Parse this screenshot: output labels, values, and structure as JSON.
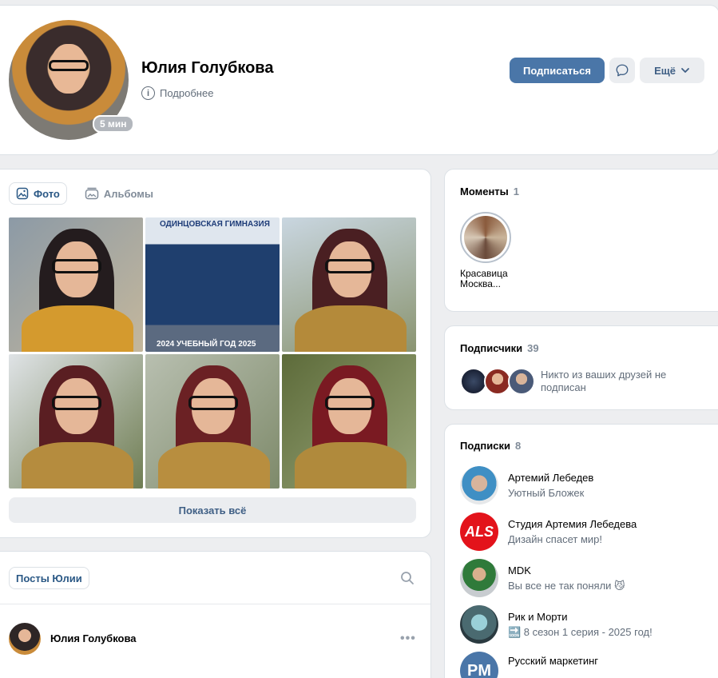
{
  "profile": {
    "name": "Юлия Голубкова",
    "details_link": "Подробнее",
    "online_badge": "5 мин",
    "subscribe_label": "Подписаться",
    "more_label": "Ещё"
  },
  "photos": {
    "tabs": [
      {
        "label": "Фото",
        "active": true
      },
      {
        "label": "Альбомы",
        "active": false
      }
    ],
    "class_photo_title": "ОДИНЦОВСКАЯ ГИМНАЗИЯ",
    "class_photo_footer": "2024 УЧЕБНЫЙ ГОД 2025",
    "show_all_label": "Показать всё"
  },
  "posts": {
    "tab_label": "Посты Юлии",
    "first_post_author": "Юлия Голубкова"
  },
  "moments": {
    "title": "Моменты",
    "count": "1",
    "item_label": "Красавица Москва..."
  },
  "followers": {
    "title": "Подписчики",
    "count": "39",
    "note": "Никто из ваших друзей не подписан"
  },
  "subscriptions": {
    "title": "Подписки",
    "count": "8",
    "items": [
      {
        "name": "Артемий Лебедев",
        "desc": "Уютный Бложек"
      },
      {
        "name": "Студия Артемия Лебедева",
        "desc": "Дизайн спасет мир!",
        "avatar_text": "ALS"
      },
      {
        "name": "MDK",
        "desc": "Вы все не так поняли 😼"
      },
      {
        "name": "Рик и Морти",
        "desc": "🔜 8 сезон 1 серия - 2025 год!"
      },
      {
        "name": "Русский маркетинг",
        "avatar_text": "PM"
      }
    ]
  },
  "colors": {
    "accent": "#4a76a8",
    "link": "#2a5885",
    "secondary_text": "#626d7a",
    "background": "#edeef0"
  }
}
